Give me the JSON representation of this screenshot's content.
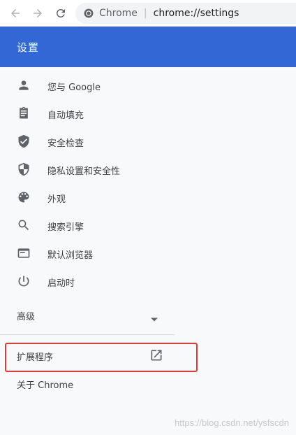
{
  "browser": {
    "site_name": "Chrome",
    "url": "chrome://settings",
    "icons": [
      "back-arrow-icon",
      "forward-arrow-icon",
      "reload-icon",
      "chrome-logo-icon"
    ]
  },
  "header": {
    "title": "设置",
    "background": "#3367d6"
  },
  "menu": {
    "items": [
      {
        "label": "您与 Google",
        "icon": "person-icon"
      },
      {
        "label": "自动填充",
        "icon": "clipboard-icon"
      },
      {
        "label": "安全检查",
        "icon": "shield-check-icon"
      },
      {
        "label": "隐私设置和安全性",
        "icon": "shield-half-icon"
      },
      {
        "label": "外观",
        "icon": "palette-icon"
      },
      {
        "label": "搜索引擎",
        "icon": "search-icon"
      },
      {
        "label": "默认浏览器",
        "icon": "browser-window-icon"
      },
      {
        "label": "启动时",
        "icon": "power-icon"
      }
    ],
    "advanced_label": "高级",
    "extensions_label": "扩展程序",
    "about_label": "关于 Chrome"
  },
  "watermark": "https://blog.csdn.net/ysfscdn",
  "colors": {
    "highlight": "#e53935",
    "icon": "#5f6368"
  }
}
